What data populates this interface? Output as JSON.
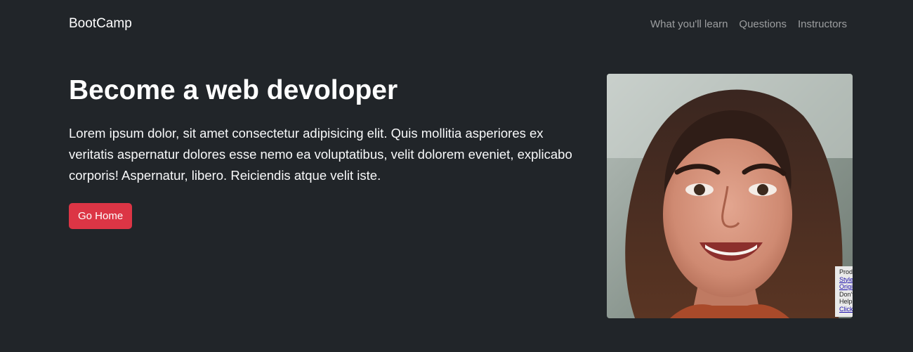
{
  "navbar": {
    "brand": "BootCamp",
    "links": [
      "What you'll learn",
      "Questions",
      "Instructors"
    ]
  },
  "hero": {
    "title": "Become a web devoloper",
    "description": "Lorem ipsum dolor, sit amet consectetur adipisicing elit. Quis mollitia asperiores ex veritatis aspernatur dolores esse nemo ea voluptatibus, velit dolorem eveniet, explicabo corporis! Aspernatur, libero. Reiciendis atque velit iste.",
    "button_label": "Go Home"
  },
  "image_overlay": {
    "lines": [
      {
        "text": "Prod",
        "link": false
      },
      {
        "text": "Style",
        "link": true
      },
      {
        "text": "Origi",
        "link": true
      },
      {
        "text": "Don't",
        "link": false
      },
      {
        "text": "Help",
        "link": false
      },
      {
        "text": "Click",
        "link": true
      }
    ]
  },
  "colors": {
    "background": "#212529",
    "accent": "#dc3545",
    "nav_link": "rgba(255,255,255,0.55)"
  }
}
